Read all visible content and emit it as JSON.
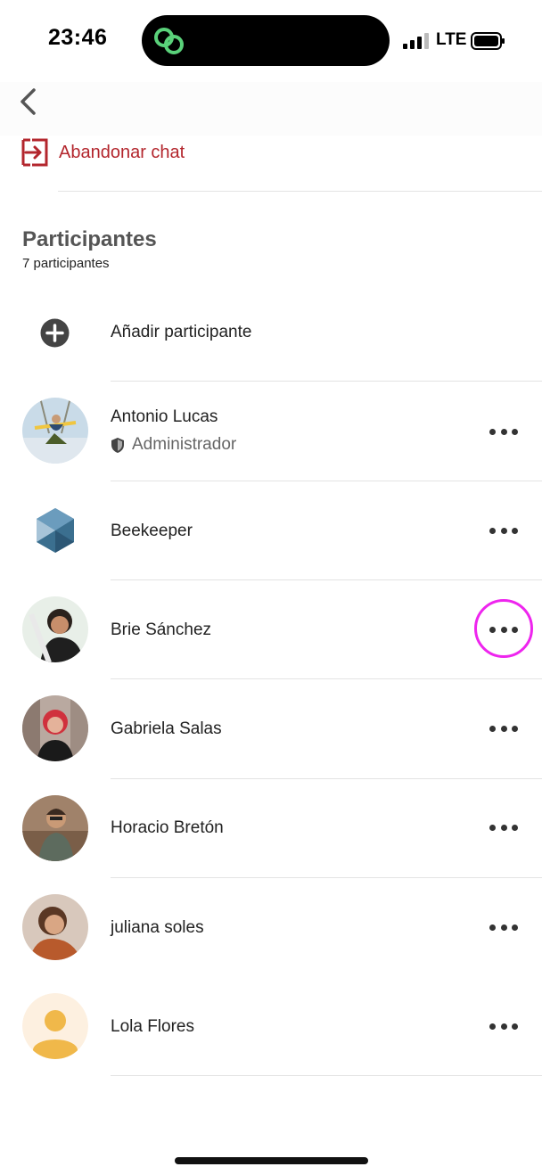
{
  "status_bar": {
    "time": "23:46",
    "network": "LTE"
  },
  "leave_chat": {
    "label": "Abandonar chat",
    "color": "#b3262d",
    "icon": "exit-icon"
  },
  "participants": {
    "title": "Participantes",
    "count_label": "7 participantes",
    "add_label": "Añadir participante",
    "list": [
      {
        "name": "Antonio Lucas",
        "role": "Administrador",
        "avatar": "photo"
      },
      {
        "name": "Beekeeper",
        "avatar": "beekeeper-logo"
      },
      {
        "name": "Brie Sánchez",
        "avatar": "photo"
      },
      {
        "name": "Gabriela Salas",
        "avatar": "photo"
      },
      {
        "name": "Horacio Bretón",
        "avatar": "photo"
      },
      {
        "name": "juliana soles",
        "avatar": "photo"
      },
      {
        "name": "Lola Flores",
        "avatar": "default-person"
      }
    ]
  },
  "colors": {
    "accent_red": "#b3262d",
    "highlight": "#ee25ee",
    "avatar_placeholder": "#f0b84a"
  }
}
